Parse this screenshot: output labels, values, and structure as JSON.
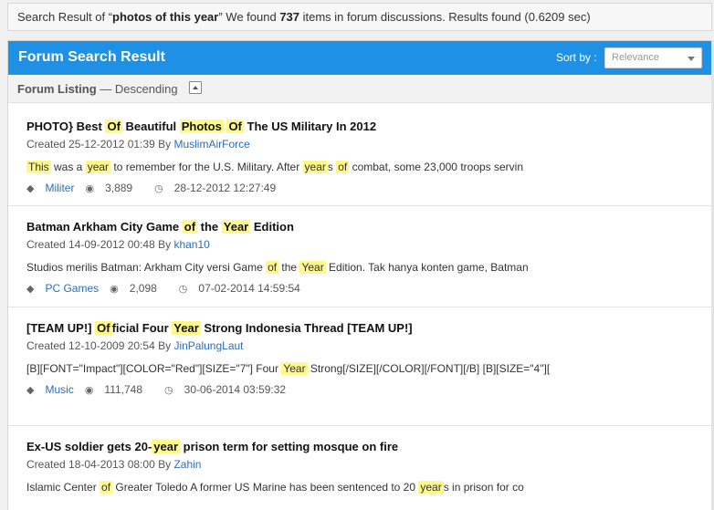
{
  "search_summary": {
    "prefix": "Search Result of “",
    "query": "photos of this year",
    "mid": "” We found ",
    "count": "737",
    "suffix": " items in forum discussions. Results found (0.6209 sec)"
  },
  "panel": {
    "title": "Forum Search Result",
    "sort_label": "Sort by :",
    "sort_value": "Relevance",
    "listing_label": "Forum Listing",
    "listing_order": " — Descending"
  },
  "results": [
    {
      "title": [
        {
          "t": "PHOTO} Best "
        },
        {
          "t": "Of",
          "h": true
        },
        {
          "t": " Beautiful "
        },
        {
          "t": "Photos",
          "h": true
        },
        {
          "t": " "
        },
        {
          "t": "Of",
          "h": true
        },
        {
          "t": " The US Military In 2012"
        }
      ],
      "created": "Created 25-12-2012 01:39 By ",
      "author": "MuslimAirForce",
      "snippet": [
        {
          "t": "This",
          "h": true
        },
        {
          "t": " was a "
        },
        {
          "t": "year",
          "h": true
        },
        {
          "t": " to remember for the U.S. Military. After "
        },
        {
          "t": "year",
          "h": true
        },
        {
          "t": "s "
        },
        {
          "t": "of",
          "h": true
        },
        {
          "t": " combat, some 23,000 troops servin"
        }
      ],
      "tag": "Militer",
      "views": "3,889",
      "last": "28-12-2012 12:27:49"
    },
    {
      "title": [
        {
          "t": "Batman Arkham City Game "
        },
        {
          "t": "of",
          "h": true
        },
        {
          "t": " the "
        },
        {
          "t": "Year",
          "h": true
        },
        {
          "t": " Edition"
        }
      ],
      "created": "Created 14-09-2012 00:48 By ",
      "author": "khan10",
      "snippet": [
        {
          "t": "Studios merilis Batman: Arkham City versi Game "
        },
        {
          "t": "of",
          "h": true
        },
        {
          "t": " the "
        },
        {
          "t": "Year",
          "h": true
        },
        {
          "t": " Edition. Tak hanya konten game, Batman"
        }
      ],
      "tag": "PC Games",
      "views": "2,098",
      "last": "07-02-2014 14:59:54"
    },
    {
      "title": [
        {
          "t": "[TEAM UP!] "
        },
        {
          "t": "Of",
          "h": true
        },
        {
          "t": "ficial Four "
        },
        {
          "t": "Year",
          "h": true
        },
        {
          "t": " Strong Indonesia Thread [TEAM UP!]"
        }
      ],
      "created": "Created 12-10-2009 20:54 By ",
      "author": "JinPalungLaut",
      "snippet": [
        {
          "t": "[B][FONT=\"Impact\"][COLOR=\"Red\"][SIZE=\"7\"] Four "
        },
        {
          "t": "Year",
          "h": true
        },
        {
          "t": " Strong[/SIZE][/COLOR][/FONT][/B] [B][SIZE=\"4\"]["
        }
      ],
      "tag": "Music",
      "views": "111,748",
      "last": "30-06-2014 03:59:32"
    },
    {
      "title": [
        {
          "t": "Ex-US soldier gets 20-"
        },
        {
          "t": "year",
          "h": true
        },
        {
          "t": " prison term for setting mosque on fire"
        }
      ],
      "created": "Created 18-04-2013 08:00 By ",
      "author": "Zahin",
      "snippet": [
        {
          "t": "Islamic Center "
        },
        {
          "t": "of",
          "h": true
        },
        {
          "t": " Greater Toledo A former US Marine has been sentenced to 20 "
        },
        {
          "t": "year",
          "h": true
        },
        {
          "t": "s in prison for co"
        }
      ],
      "tag": "",
      "views": "",
      "last": ""
    }
  ],
  "icons": {
    "tag": "tag-icon",
    "views": "eye-icon",
    "last": "clock-icon"
  }
}
